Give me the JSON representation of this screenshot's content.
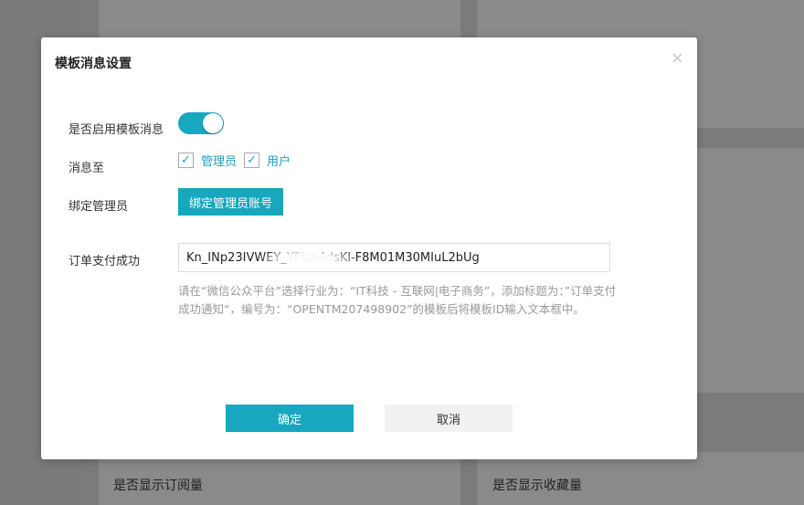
{
  "background": {
    "card_label_left": "是否显示订阅量",
    "card_label_right": "是否显示收藏量"
  },
  "modal": {
    "title": "模板消息设置",
    "close_symbol": "×",
    "enable_label": "是否启用模板消息",
    "enable_on": true,
    "notify_label": "消息至",
    "notify_options": [
      {
        "label": "管理员",
        "checked": true
      },
      {
        "label": "用户",
        "checked": true
      }
    ],
    "check_symbol": "✓",
    "bind_label": "绑定管理员",
    "bind_button": "绑定管理员账号",
    "order_label": "订单支付成功",
    "order_value": "Kn_INp23IVWEY_YPbw4dsKl-F8M01M30MIuL2bUg",
    "help_text": "请在“微信公众平台”选择行业为：“IT科技 - 互联网|电子商务”，添加标题为：”订单支付成功通知“，编号为：“OPENTM207498902”的模板后将模板ID输入文本框中。",
    "ok_button": "确定",
    "cancel_button": "取消"
  },
  "colors": {
    "accent": "#17a7bf",
    "overlay": "#7b7b7b"
  }
}
